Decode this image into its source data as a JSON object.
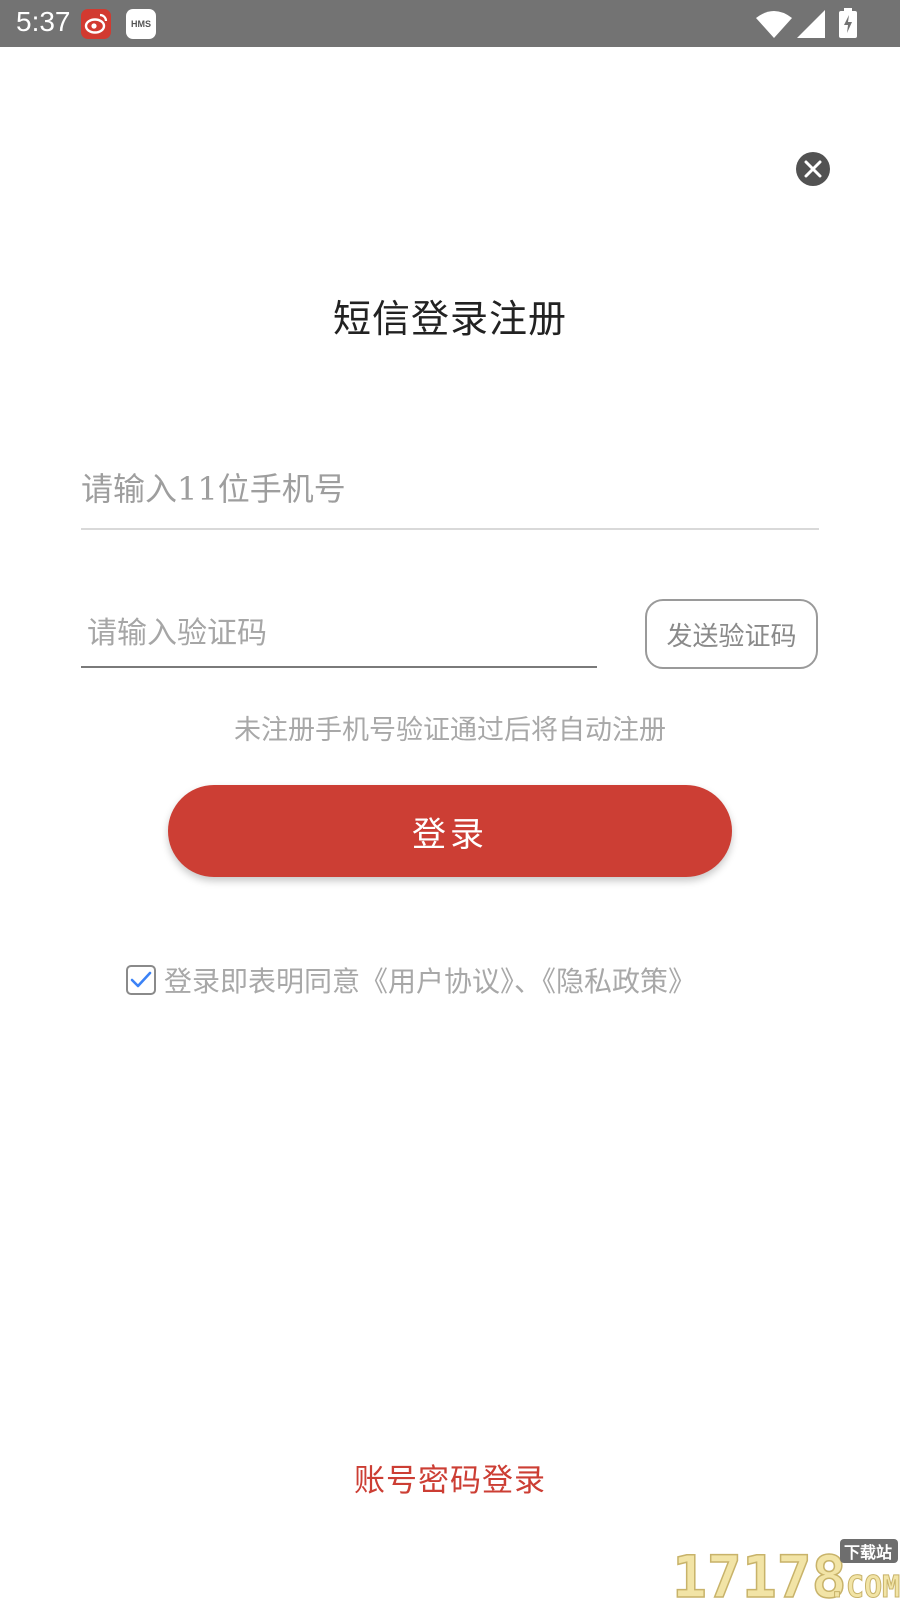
{
  "status_bar": {
    "time": "5:37",
    "hms_label": "HMS"
  },
  "title": "短信登录注册",
  "phone_input": {
    "placeholder": "请输入11位手机号"
  },
  "code_input": {
    "placeholder": "请输入验证码"
  },
  "send_code_label": "发送验证码",
  "hint": "未注册手机号验证通过后将自动注册",
  "login_label": "登录",
  "agreement": {
    "checked": true,
    "prefix": "登录即表明同意",
    "user_agreement": "《用户协议》",
    "separator": "、",
    "privacy_policy": "《隐私政策》"
  },
  "account_login_label": "账号密码登录",
  "watermark": {
    "number": "17178",
    "badge": "下载站",
    "suffix": ".COM"
  },
  "colors": {
    "accent": "#cc3e34",
    "status_bar": "#737373",
    "check": "#3b82f6"
  },
  "icons": {
    "close": "close-circle-icon",
    "check": "checkmark-icon",
    "wifi": "wifi-icon",
    "signal": "cell-signal-icon",
    "battery": "battery-charging-icon"
  }
}
